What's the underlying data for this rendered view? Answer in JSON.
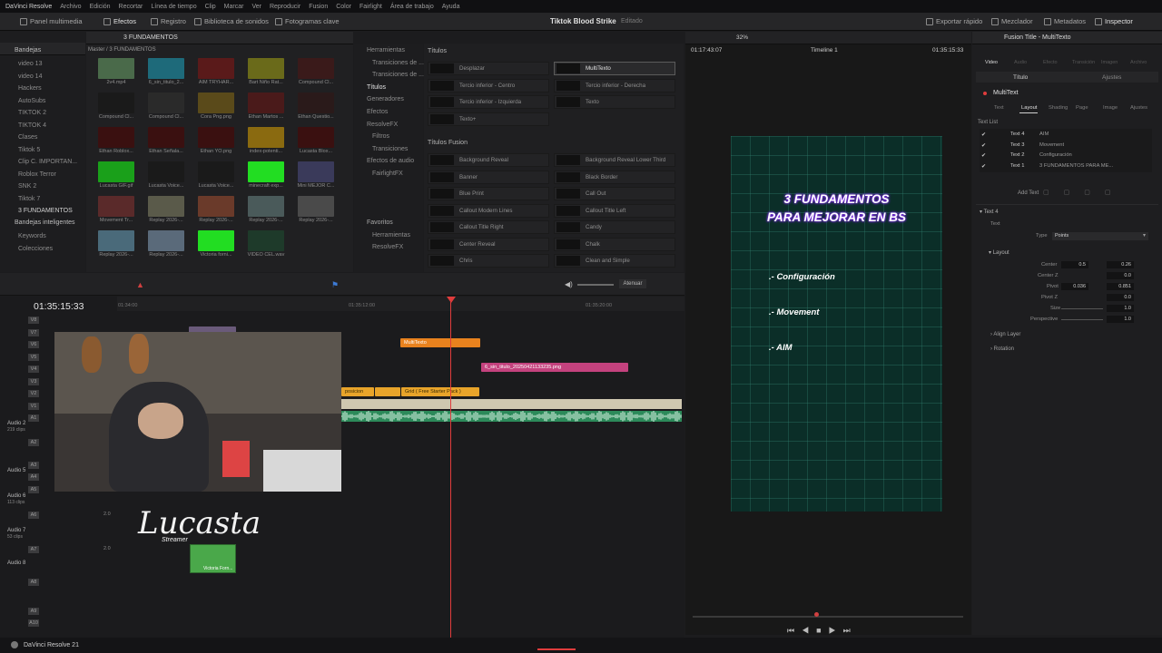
{
  "menu": {
    "app": "DaVinci Resolve",
    "items": [
      "Archivo",
      "Edición",
      "Recortar",
      "Línea de tiempo",
      "Clip",
      "Marcar",
      "Ver",
      "Reproducir",
      "Fusion",
      "Color",
      "Fairlight",
      "Área de trabajo",
      "Ayuda"
    ]
  },
  "toolbar": {
    "media_pool": "Panel multimedia",
    "effects": "Efectos",
    "index": "Registro",
    "sound_library": "Biblioteca de sonidos",
    "keyframes": "Fotogramas clave",
    "project_title": "Tiktok Blood Strike",
    "project_status": "Editado",
    "quick_export": "Exportar rápido",
    "mixer": "Mezclador",
    "metadata": "Metadatos",
    "inspector": "Inspector"
  },
  "media_pool": {
    "bins_header": "Bandejas",
    "current_bin": "3 FUNDAMENTOS",
    "breadcrumb": "Master / 3 FUNDAMENTOS",
    "bins": [
      "video 13",
      "video 14",
      "Hackers",
      "AutoSubs",
      "TIKTOK 2",
      "TIKTOK 4",
      "Clases",
      "Tiktok 5",
      "Clip C. IMPORTAN...",
      "Roblox Terror",
      "SNK 2",
      "Tiktok 7",
      "3 FUNDAMENTOS"
    ],
    "smart_bins_header": "Bandejas inteligentes",
    "smart_bins": [
      "Keywords",
      "Colecciones"
    ],
    "clips": [
      {
        "label": "2v4.mp4",
        "color": "#4a6a4a"
      },
      {
        "label": "6_sin_titulo_2...",
        "color": "#1e6a7a"
      },
      {
        "label": "AIM TRYHAR...",
        "color": "#5a1a1a"
      },
      {
        "label": "Bart Niño Rat...",
        "color": "#6a6a1a"
      },
      {
        "label": "Compound Cl...",
        "color": "#3a1a1a"
      },
      {
        "label": "Compound Cl...",
        "color": "#1a1a1a"
      },
      {
        "label": "Compound Cl...",
        "color": "#2a2a2a"
      },
      {
        "label": "Cora Png.png",
        "color": "#5a4a1a"
      },
      {
        "label": "Ethan Martos ...",
        "color": "#4a1a1a"
      },
      {
        "label": "Ethan Questio...",
        "color": "#2a1a1a"
      },
      {
        "label": "Ethan Roblox...",
        "color": "#3a1010"
      },
      {
        "label": "Ethan Señala...",
        "color": "#3a1010"
      },
      {
        "label": "Ethan YO.png",
        "color": "#3a1010"
      },
      {
        "label": "index-potenti...",
        "color": "#8a6a10"
      },
      {
        "label": "Lucasta Blox...",
        "color": "#3a1010"
      },
      {
        "label": "Lucasta GIF.gif",
        "color": "#1aa01a"
      },
      {
        "label": "Lucasta Voice...",
        "color": "#1a1a1a"
      },
      {
        "label": "Lucasta Voice...",
        "color": "#1a1a1a"
      },
      {
        "label": "minecraft exp...",
        "color": "#22dd22"
      },
      {
        "label": "Mini MEJOR C...",
        "color": "#3a3a5a"
      },
      {
        "label": "Movement Tr...",
        "color": "#5a2a2a"
      },
      {
        "label": "Replay 2026-...",
        "color": "#5a5a4a"
      },
      {
        "label": "Replay 2026-...",
        "color": "#6a3a2a"
      },
      {
        "label": "Replay 2026-...",
        "color": "#4a5a5a"
      },
      {
        "label": "Replay 2026-...",
        "color": "#4a4a4a"
      },
      {
        "label": "Replay 2026-...",
        "color": "#4a6a7a"
      },
      {
        "label": "Replay 2026-...",
        "color": "#5a6a7a"
      },
      {
        "label": "Victoria forni...",
        "color": "#22dd22"
      },
      {
        "label": "VIDEO CEL.wav",
        "color": "#1e3a2a"
      }
    ]
  },
  "effects": {
    "tree": [
      "Herramientas",
      "Transiciones de ...",
      "Transiciones de ...",
      "Títulos",
      "Generadores",
      "Efectos",
      "ResolveFX",
      "Filtros",
      "Transiciones",
      "Efectos de audio",
      "FairlightFX"
    ],
    "favorites_header": "Favoritos",
    "favorites": [
      "Herramientas",
      "ResolveFX"
    ],
    "titles_header": "Títulos",
    "titles": [
      "Desplazar",
      "MultiTexto",
      "Tercio inferior - Centro",
      "Tercio inferior - Derecha",
      "Tercio inferior - Izquierda",
      "Texto",
      "Texto+"
    ],
    "fusion_header": "Títulos Fusion",
    "fusion": [
      "Background Reveal",
      "Background Reveal Lower Third",
      "Banner",
      "Black Border",
      "Blue Print",
      "Call Out",
      "Callout Modern Lines",
      "Callout Title Left",
      "Callout Title Right",
      "Candy",
      "Center Reveal",
      "Chalk",
      "Chris",
      "Clean and Simple"
    ]
  },
  "viewer": {
    "timecode_left": "01:17:43:07",
    "zoom": "32%",
    "timeline_name": "Timeline 1",
    "timecode_right": "01:35:15:33",
    "canvas": {
      "title_line1": "3 FUNDAMENTOS",
      "title_line2": "PARA MEJORAR EN BS",
      "items": [
        ".- Configuración",
        ".- Movement",
        ".- AIM"
      ]
    }
  },
  "inspector": {
    "title": "Fusion Title - MultiTexto",
    "tabs": [
      "Video",
      "Audio",
      "Efecto",
      "Transición",
      "Imagen",
      "Archivo"
    ],
    "subtabs": [
      "Título",
      "Ajustes"
    ],
    "node": "MultiText",
    "layout_tabs": [
      "Text",
      "Layout",
      "Shading",
      "Page",
      "Image",
      "Ajustes"
    ],
    "text_list_label": "Text List",
    "texts": [
      {
        "name": "Text 4",
        "value": "AIM"
      },
      {
        "name": "Text 3",
        "value": "Movement"
      },
      {
        "name": "Text 2",
        "value": "Configuración"
      },
      {
        "name": "Text 1",
        "value": "3 FUNDAMENTOS PARA ME..."
      }
    ],
    "add_text": "Add Text",
    "section_text4": "Text 4",
    "text_label": "Text",
    "type_label": "Type",
    "type_value": "Points",
    "section_layout": "Layout",
    "center_label": "Center",
    "center_x": "0.5",
    "center_y": "0.26",
    "center_z_label": "Center Z",
    "center_z": "0.0",
    "pivot_label": "Pivot",
    "pivot_x": "0.036",
    "pivot_y": "0.851",
    "pivot_z_label": "Pivot Z",
    "pivot_z": "0.0",
    "size_label": "Size",
    "size": "1.0",
    "perspective_label": "Perspective",
    "perspective": "1.0",
    "align_layer": "Align Layer",
    "rotation": "Rotation"
  },
  "timeline": {
    "timecode": "01:35:15:33",
    "ruler": [
      "01:34:00",
      "01:35:12:00",
      "01:35:20:00"
    ],
    "attenuate": "Atenuar",
    "video_tracks": [
      "V8",
      "V7",
      "V6",
      "V5",
      "V4",
      "V3",
      "V2",
      "V1"
    ],
    "audio_tracks": [
      {
        "id": "A1",
        "name": ""
      },
      {
        "id": "A2",
        "name": "Audio 2",
        "sub": "219 clips"
      },
      {
        "id": "A3",
        "name": ""
      },
      {
        "id": "A4",
        "name": ""
      },
      {
        "id": "A5",
        "name": "Audio 5"
      },
      {
        "id": "A6",
        "name": "Audio 6",
        "sub": "113 clips"
      },
      {
        "id": "A7",
        "name": "Audio 7",
        "sub": "53 clips"
      },
      {
        "id": "A8",
        "name": "Audio 8"
      },
      {
        "id": "A9",
        "name": ""
      },
      {
        "id": "A10",
        "name": ""
      }
    ],
    "audio_level": "2.0",
    "clips": {
      "multitext": "MultiTexto",
      "png": "6_sin_titulo_20250421133235.png",
      "grid": "Grid ( Free Starter Pack )",
      "left_v2": "posicion",
      "victoria": "Victoria Forn..."
    },
    "watermark": "Lucasta",
    "watermark_sub": "Streamer"
  },
  "bottom": {
    "app": "DaVinci Resolve 21"
  }
}
